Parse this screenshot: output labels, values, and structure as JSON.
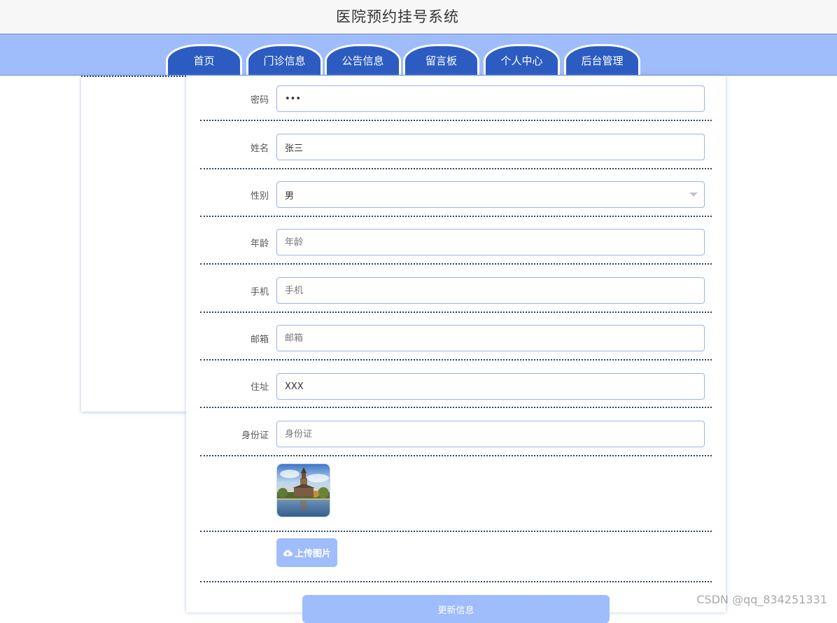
{
  "header": {
    "site_title": "医院预约挂号系统"
  },
  "nav": {
    "tabs": [
      {
        "label": "首页"
      },
      {
        "label": "门诊信息"
      },
      {
        "label": "公告信息"
      },
      {
        "label": "留言板"
      },
      {
        "label": "个人中心"
      },
      {
        "label": "后台管理"
      }
    ]
  },
  "form": {
    "password": {
      "label": "密码",
      "value": "•••"
    },
    "name": {
      "label": "姓名",
      "value": "张三"
    },
    "gender": {
      "label": "性别",
      "value": "男"
    },
    "age": {
      "label": "年龄",
      "value": "",
      "placeholder": "年龄"
    },
    "phone": {
      "label": "手机",
      "value": "",
      "placeholder": "手机"
    },
    "email": {
      "label": "邮箱",
      "value": "",
      "placeholder": "邮箱"
    },
    "address": {
      "label": "住址",
      "value": "XXX"
    },
    "id_card": {
      "label": "身份证",
      "value": "",
      "placeholder": "身份证"
    },
    "upload_label": "上传图片",
    "submit_label": "更新信息"
  },
  "watermark": "CSDN @qq_834251331",
  "colors": {
    "nav_background": "#9fbcfb",
    "tab_background": "#2c5cc1",
    "button_background": "#9fbcfb",
    "field_border": "#9bb5e6"
  },
  "icons": {
    "upload": "cloud-upload-icon",
    "select": "chevron-down-icon"
  }
}
